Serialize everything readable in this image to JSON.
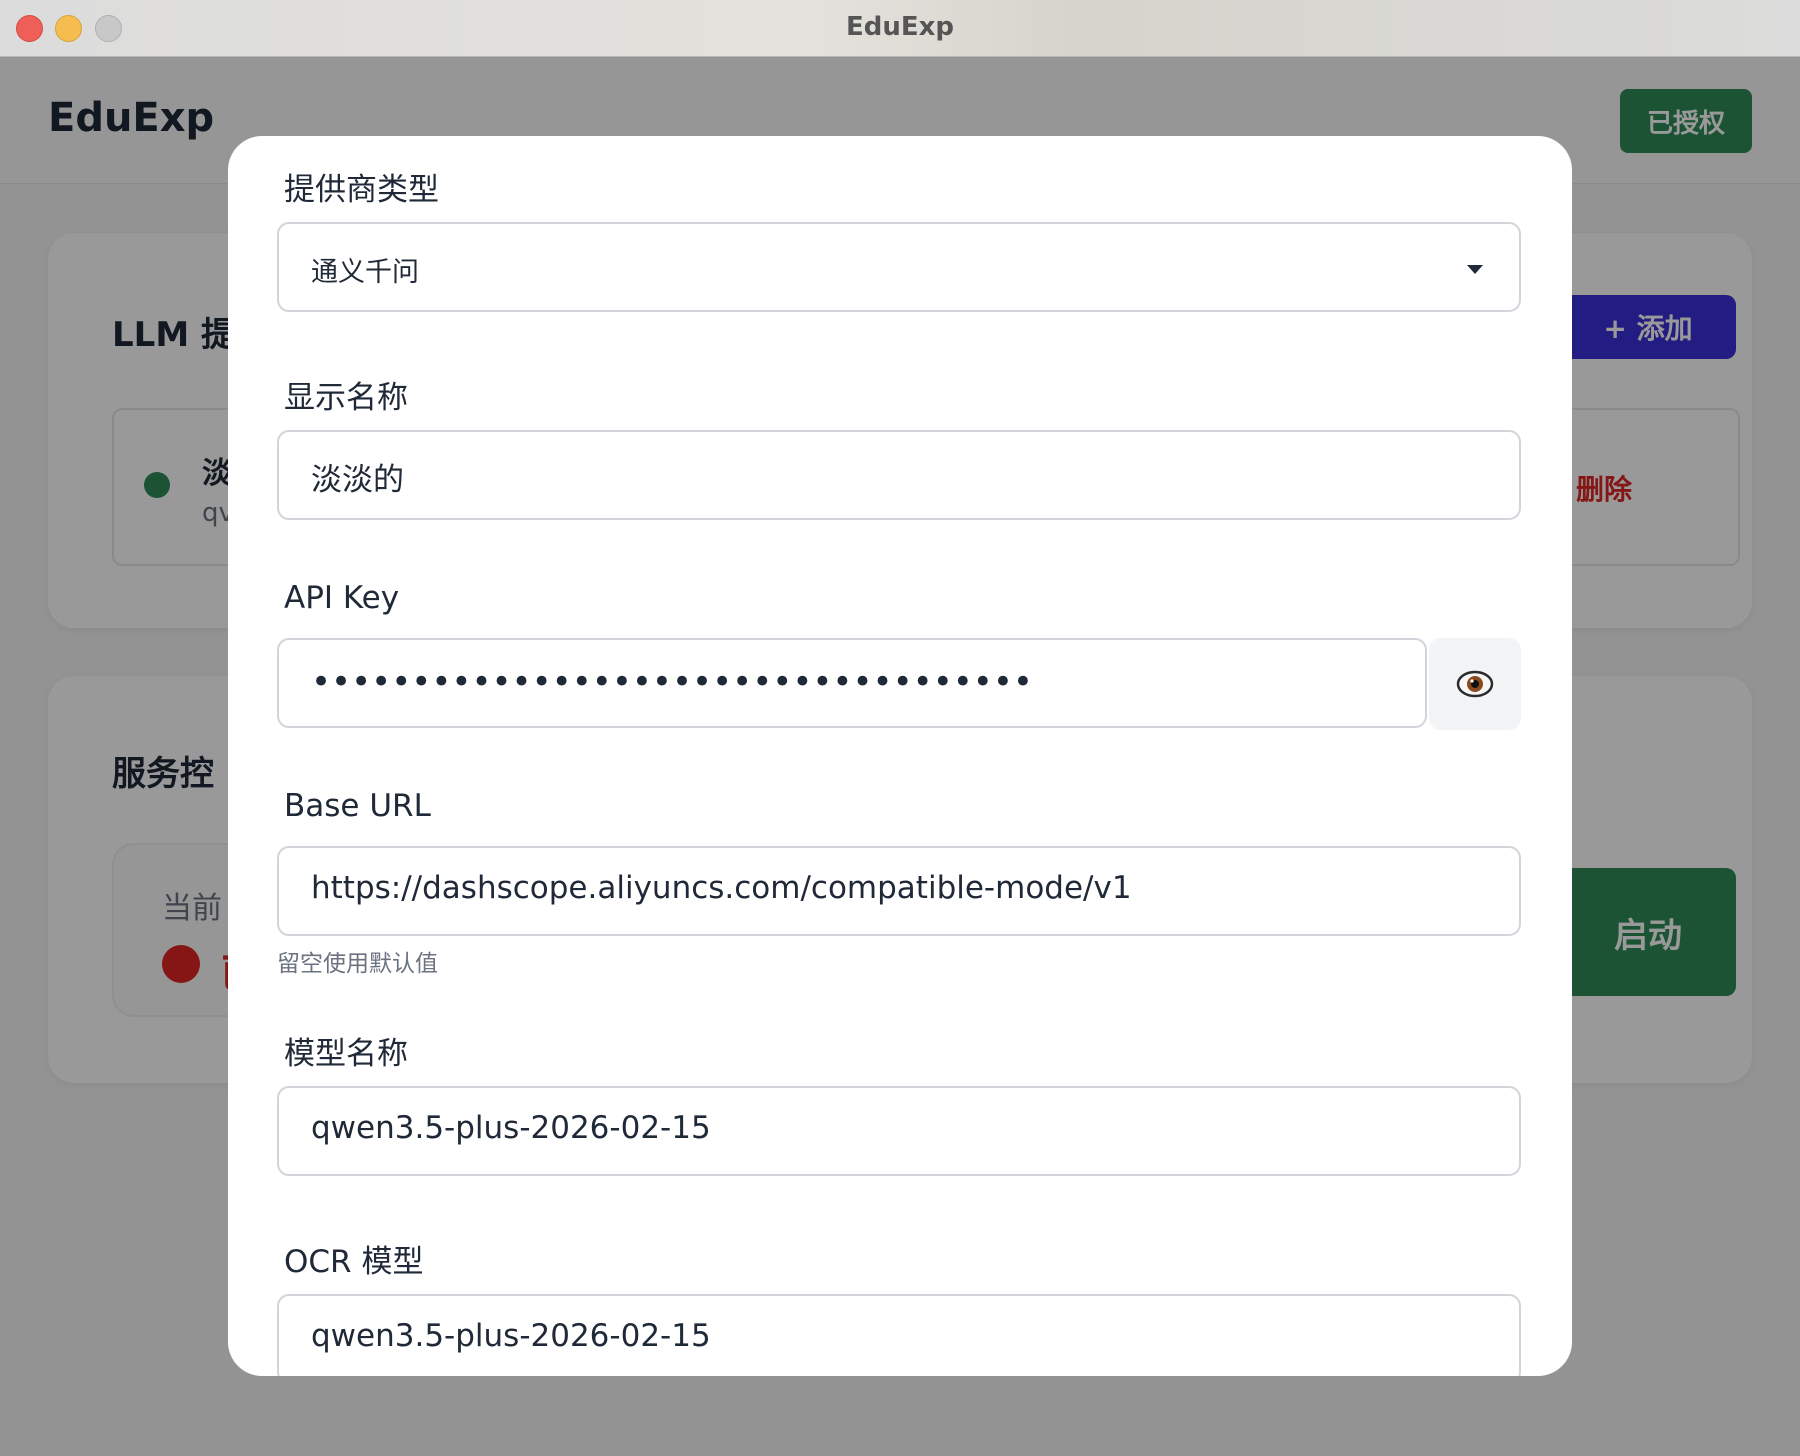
{
  "window": {
    "title": "EduExp"
  },
  "header": {
    "logo": "EduExp",
    "auth_button": "已授权"
  },
  "llm_card": {
    "title": "LLM 提",
    "add_button": "+ 添加",
    "provider": {
      "name": "淡",
      "subtitle": "qv",
      "delete_label": "删除"
    }
  },
  "service_card": {
    "title": "服务控",
    "status_label": "当前",
    "status_text": "已",
    "start_button": "启动"
  },
  "modal": {
    "provider_type": {
      "label": "提供商类型",
      "value": "通义千问"
    },
    "display_name": {
      "label": "显示名称",
      "value": "淡淡的"
    },
    "api_key": {
      "label": "API Key",
      "masked_value": "••••••••••••••••••••••••••••••••••••",
      "toggle_icon": "eye-icon"
    },
    "base_url": {
      "label": "Base URL",
      "value": "https://dashscope.aliyuncs.com/compatible-mode/v1",
      "hint": "留空使用默认值"
    },
    "model_name": {
      "label": "模型名称",
      "value": "qwen3.5-plus-2026-02-15"
    },
    "ocr_model": {
      "label": "OCR 模型",
      "value": "qwen3.5-plus-2026-02-15"
    }
  },
  "colors": {
    "primary_green": "#2e8b57",
    "accent_purple": "#3b30d9",
    "danger_red": "#dc2626"
  }
}
